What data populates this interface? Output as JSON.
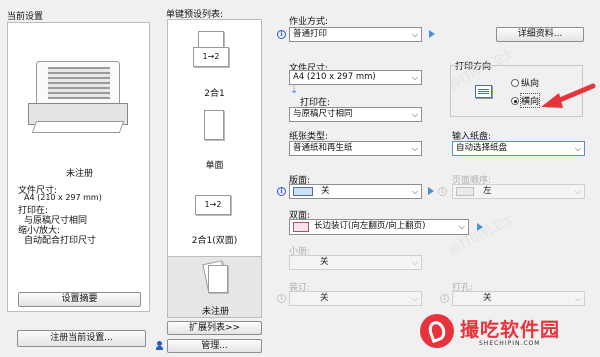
{
  "left": {
    "title": "当前设置",
    "status": "未注册",
    "fields": [
      "文件尺寸:",
      "A4 (210 x 297 mm)",
      "打印在:",
      "与原稿尺寸相同",
      "缩小/放大:",
      "自动配合打印尺寸"
    ],
    "summary_button": "设置摘要",
    "register_button": "注册当前设置..."
  },
  "presets": {
    "title": "单键预设列表:",
    "items": [
      {
        "icon": "1→2",
        "label": "2合1"
      },
      {
        "label": "单面"
      },
      {
        "icon": "1→2",
        "label": "2合1(双面)"
      },
      {
        "label": "未注册"
      }
    ],
    "expand_button": "扩展列表>>",
    "manage_button": "管理..."
  },
  "form": {
    "work_mode": {
      "label": "作业方式:",
      "value": "普通打印",
      "details_button": "详细资料..."
    },
    "file_size": {
      "label": "文件尺寸:",
      "value": "A4 (210 x 297 mm)"
    },
    "print_on": {
      "label": "打印在:",
      "value": "与原稿尺寸相同"
    },
    "orientation": {
      "label": "打印方向",
      "portrait": "纵向",
      "landscape": "横向",
      "selected": "landscape"
    },
    "paper_type": {
      "label": "纸张类型:",
      "value": "普通纸和再生纸"
    },
    "input_tray": {
      "label": "输入纸盘:",
      "value": "自动选择纸盘"
    },
    "duplex_layout": {
      "label": "版面:",
      "value": "关"
    },
    "page_order": {
      "label": "页面顺序:",
      "value": "左"
    },
    "duplex": {
      "label": "双面:",
      "value": "长边装订(向左翻页/向上翻页)"
    },
    "booklet": {
      "label": "小册:",
      "value": "关"
    },
    "staple": {
      "label": "装订:",
      "value": "关"
    },
    "punch": {
      "label": "打孔:",
      "value": "关"
    }
  },
  "watermark_text": "@打印机卫士",
  "brand": {
    "name": "撮吃软件园",
    "url": "SHECHIPIN.COM"
  },
  "colors": {
    "accent": "#2a5cc8",
    "arrow": "#e8323c",
    "brand": "#e8323c"
  }
}
